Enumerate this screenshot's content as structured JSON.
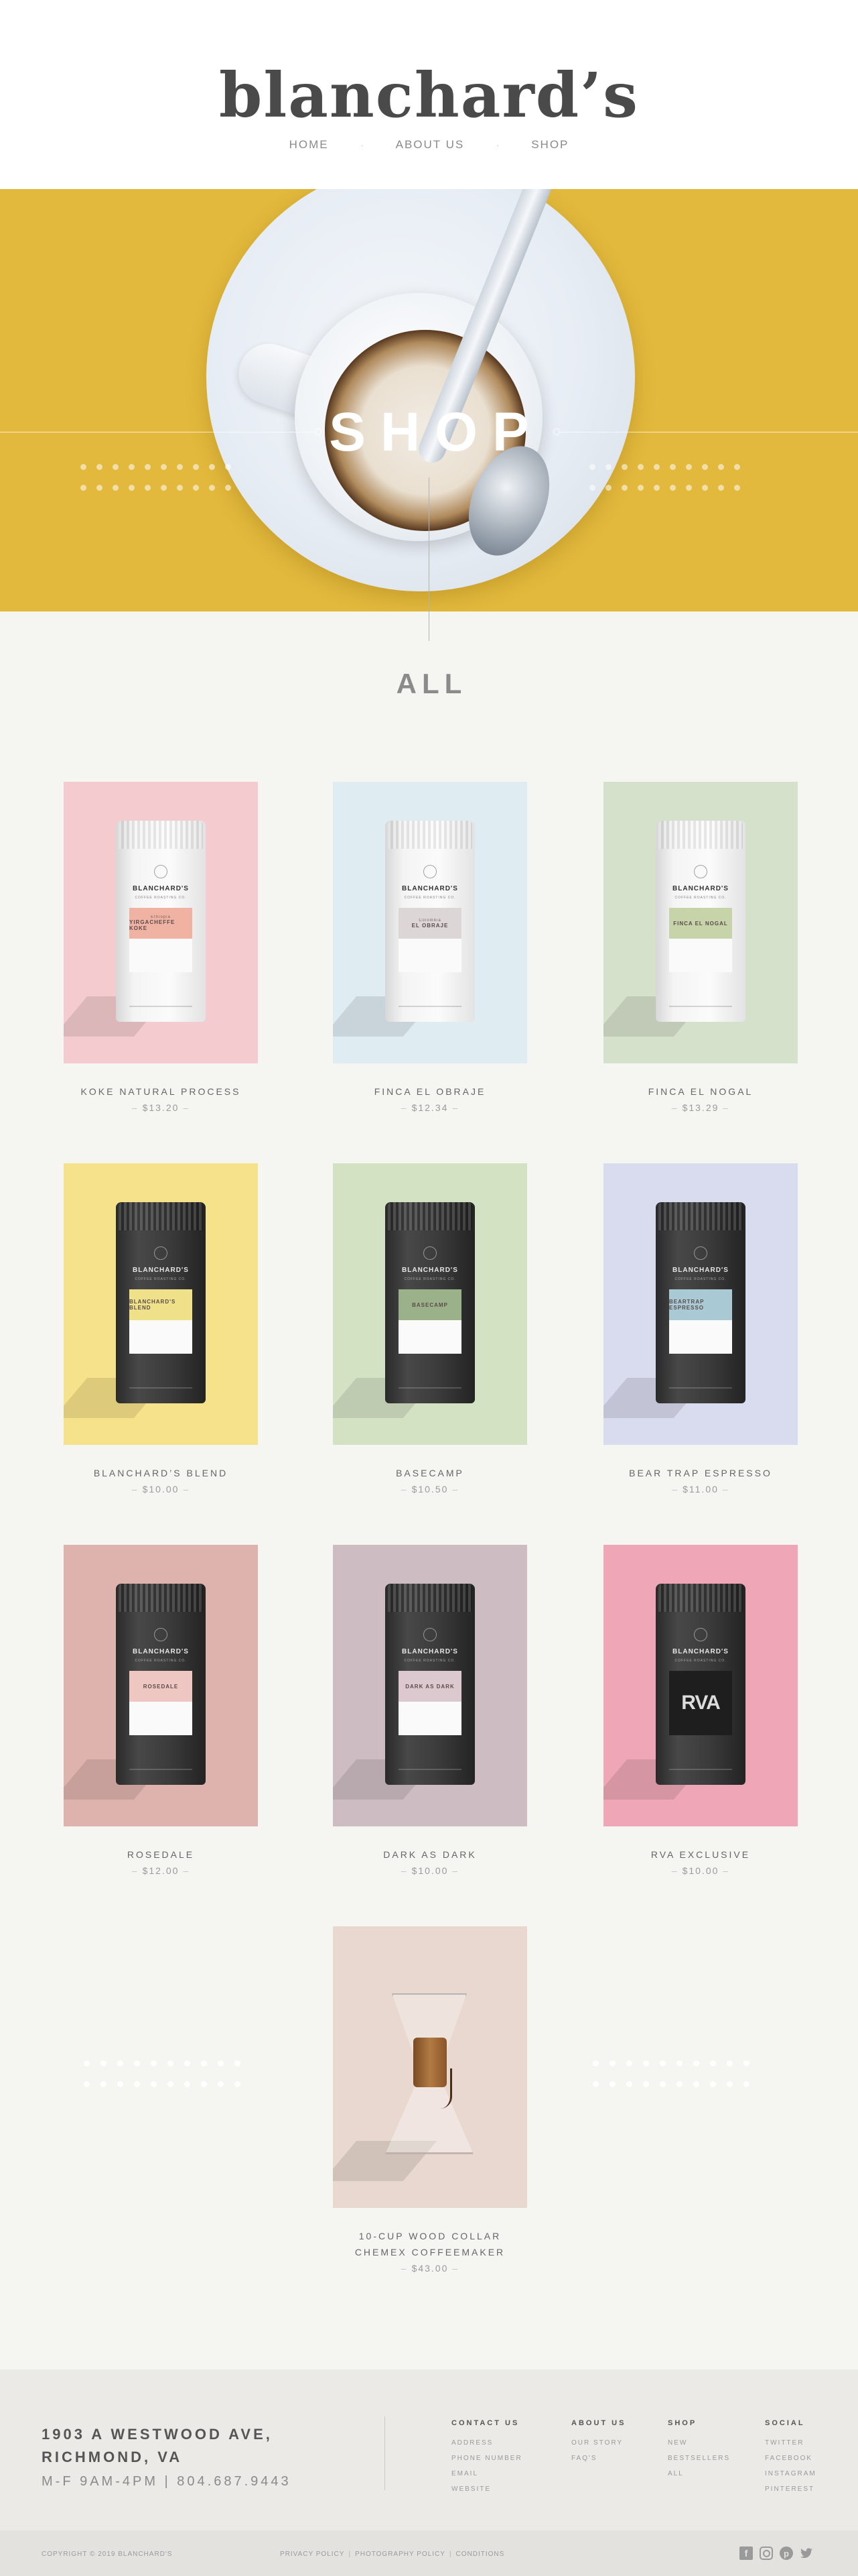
{
  "header": {
    "logo": "blanchard’s",
    "nav": [
      {
        "label": "HOME"
      },
      {
        "label": "ABOUT US"
      },
      {
        "label": "SHOP"
      }
    ]
  },
  "hero": {
    "title": "SHOP"
  },
  "section": {
    "title": "ALL"
  },
  "products": [
    {
      "name": "KOKE NATURAL PROCESS",
      "price": "$13.20",
      "bg": "#f4ccd0",
      "bag": "light",
      "bag_brand": "BLANCHARD'S",
      "bag_sub": "COFFEE ROASTING CO.",
      "bag_origin": "Ethiopia",
      "bag_label": "YIRGACHEFFE KOKE",
      "band": "#f0b3a3"
    },
    {
      "name": "FINCA EL OBRAJE",
      "price": "$12.34",
      "bg": "#dfedf3",
      "bag": "light",
      "bag_brand": "BLANCHARD'S",
      "bag_sub": "COFFEE ROASTING CO.",
      "bag_origin": "Colombia",
      "bag_label": "EL OBRAJE",
      "band": "#dcd6d6"
    },
    {
      "name": "FINCA EL NOGAL",
      "price": "$13.29",
      "bg": "#d6e1cb",
      "bag": "light",
      "bag_brand": "BLANCHARD'S",
      "bag_sub": "COFFEE ROASTING CO.",
      "bag_origin": "",
      "bag_label": "FINCA EL NOGAL",
      "band": "#c7d3a8"
    },
    {
      "name": "BLANCHARD’S BLEND",
      "price": "$10.00",
      "bg": "#f6e28a",
      "bag": "dark",
      "bag_brand": "BLANCHARD'S",
      "bag_sub": "COFFEE ROASTING CO.",
      "bag_origin": "",
      "bag_label": "BLANCHARD'S BLEND",
      "band": "#efe189"
    },
    {
      "name": "BASECAMP",
      "price": "$10.50",
      "bg": "#d4e2c4",
      "bag": "dark",
      "bag_brand": "BLANCHARD'S",
      "bag_sub": "COFFEE ROASTING CO.",
      "bag_origin": "",
      "bag_label": "BASECAMP",
      "band": "#9bb18a"
    },
    {
      "name": "BEAR TRAP ESPRESSO",
      "price": "$11.00",
      "bg": "#d9dbef",
      "bag": "dark",
      "bag_brand": "BLANCHARD'S",
      "bag_sub": "COFFEE ROASTING CO.",
      "bag_origin": "",
      "bag_label": "BEARTRAP ESPRESSO",
      "band": "#a9c9d4"
    },
    {
      "name": "ROSEDALE",
      "price": "$12.00",
      "bg": "#deb3ad",
      "bag": "dark",
      "bag_brand": "BLANCHARD'S",
      "bag_sub": "COFFEE ROASTING CO.",
      "bag_origin": "",
      "bag_label": "ROSEDALE",
      "band": "#efc7c2"
    },
    {
      "name": "DARK AS DARK",
      "price": "$10.00",
      "bg": "#cdbdc2",
      "bag": "dark",
      "bag_brand": "BLANCHARD'S",
      "bag_sub": "COFFEE ROASTING CO.",
      "bag_origin": "",
      "bag_label": "DARK AS DARK",
      "band": "#dcc9cf"
    },
    {
      "name": "RVA EXCLUSIVE",
      "price": "$10.00",
      "bg": "#efa6b6",
      "bag": "dark",
      "bag_brand": "BLANCHARD'S",
      "bag_sub": "COFFEE ROASTING CO.",
      "bag_origin": "",
      "bag_label": "RVA",
      "band": "#1e1e1e"
    },
    {
      "name": "10-CUP WOOD COLLAR CHEMEX COFFEEMAKER",
      "price": "$43.00",
      "bg": "#e8d8cf",
      "bag": "chemex"
    }
  ],
  "footer": {
    "address_line1": "1903 A WESTWOOD AVE,",
    "address_line2": "RICHMOND, VA",
    "hours": "M-F 9AM-4PM | 804.687.9443",
    "columns": [
      {
        "title": "CONTACT US",
        "links": [
          "ADDRESS",
          "PHONE NUMBER",
          "EMAIL",
          "WEBSITE"
        ]
      },
      {
        "title": "ABOUT US",
        "links": [
          "OUR STORY",
          "FAQ'S"
        ]
      },
      {
        "title": "SHOP",
        "links": [
          "NEW",
          "BESTSELLERS",
          "ALL"
        ]
      },
      {
        "title": "SOCIAL",
        "links": [
          "TWITTER",
          "FACEBOOK",
          "INSTAGRAM",
          "PINTEREST"
        ]
      }
    ],
    "copyright": "COPYRIGHT © 2019 BLANCHARD'S",
    "policies": [
      "PRIVACY POLICY",
      "PHOTOGRAPHY POLICY",
      "CONDITIONS"
    ],
    "social_icons": [
      "facebook-icon",
      "instagram-icon",
      "pinterest-icon",
      "twitter-icon"
    ]
  },
  "colors": {
    "hero_bg": "#e2b93c",
    "page_bg": "#f5f5f2",
    "text": "#555555"
  }
}
